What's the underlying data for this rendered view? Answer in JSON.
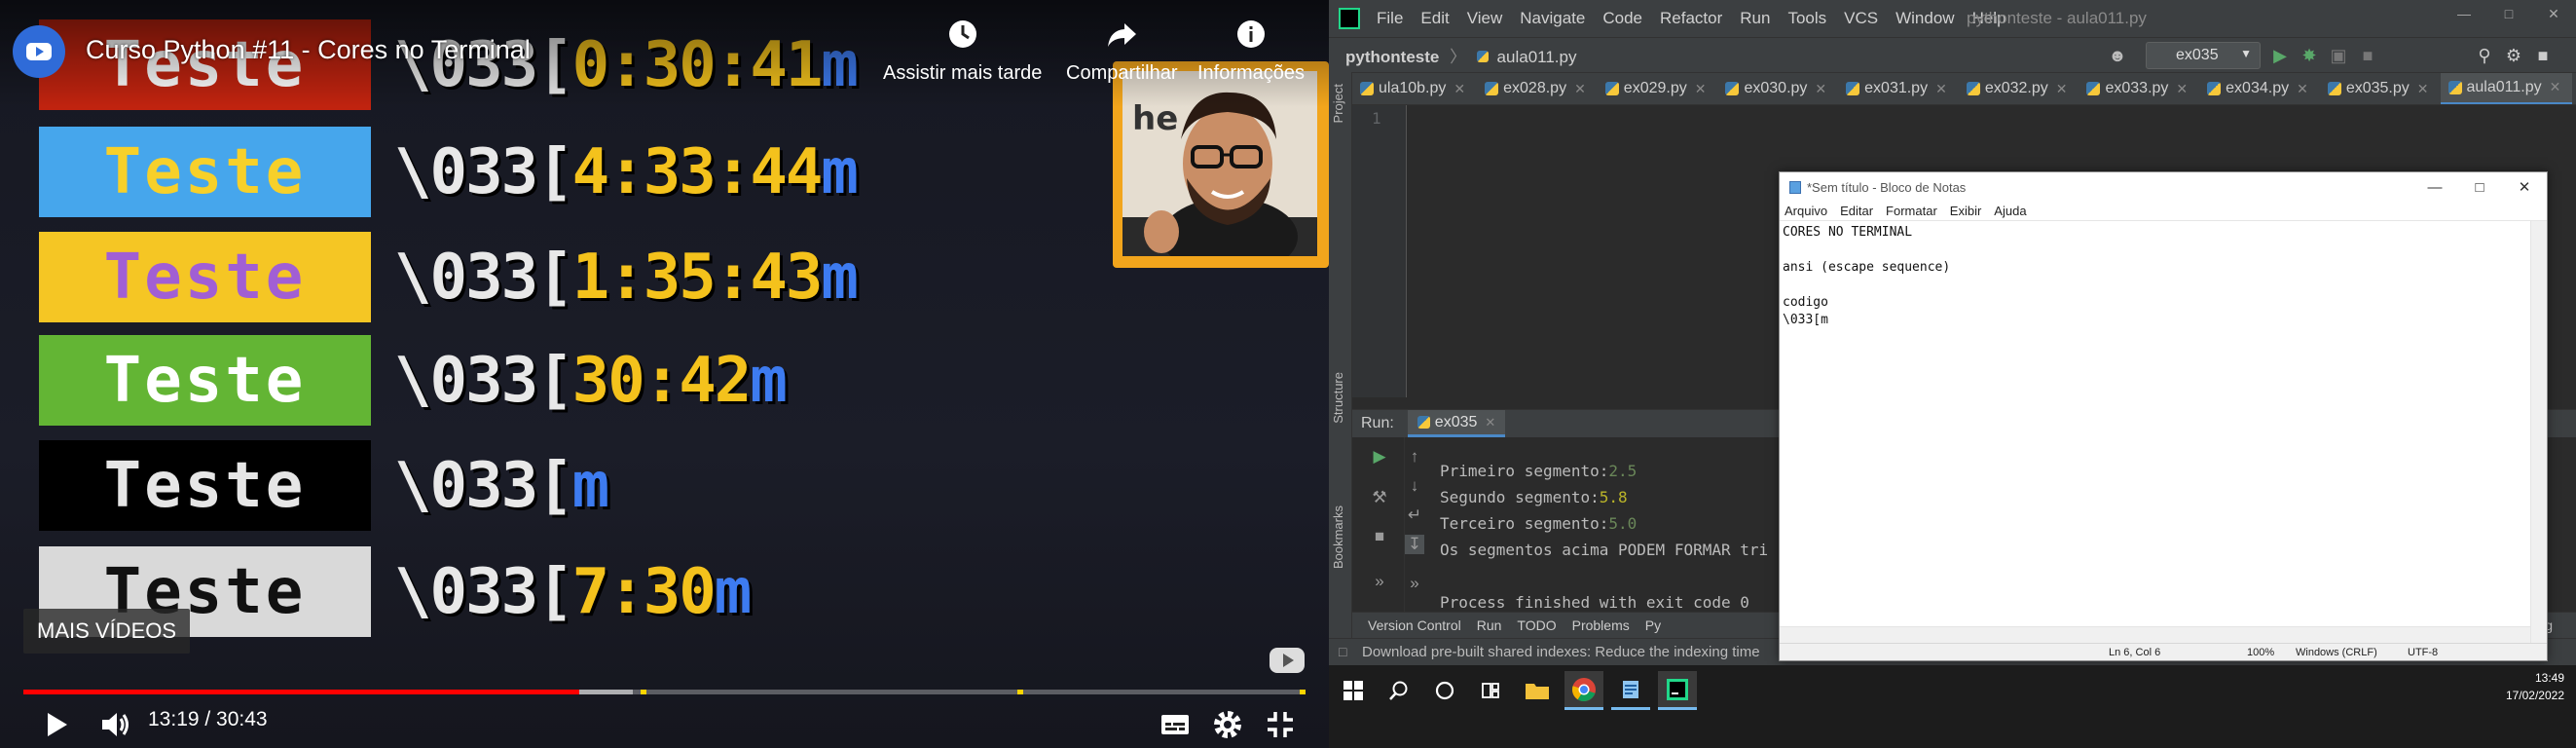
{
  "video": {
    "title": "Curso Python #11 - Cores no Terminal",
    "actions": {
      "watch_later": "Assistir mais tarde",
      "share": "Compartilhar",
      "info": "Informações"
    },
    "more_videos": "MAIS VÍDEOS",
    "time": "13:19 / 30:43",
    "progress_played_fraction": 0.4335,
    "progress_loaded_fraction": 0.475,
    "slide": {
      "rows": [
        {
          "box_text": "Teste",
          "box_bg": "#c0230f",
          "box_fg": "#ffffff",
          "code_prefix": "\\033",
          "code_bracket": "[",
          "code_args": "0:30:41",
          "code_m": "m"
        },
        {
          "box_text": "Teste",
          "box_bg": "#46a6ec",
          "box_fg": "#f7d02a",
          "code_prefix": "\\033",
          "code_bracket": "[",
          "code_args": "4:33:44",
          "code_m": "m"
        },
        {
          "box_text": "Teste",
          "box_bg": "#f5c624",
          "box_fg": "#a15fd4",
          "code_prefix": "\\033",
          "code_bracket": "[",
          "code_args": "1:35:43",
          "code_m": "m"
        },
        {
          "box_text": "Teste",
          "box_bg": "#63b534",
          "box_fg": "#ffffff",
          "code_prefix": "\\033",
          "code_bracket": "[",
          "code_args": "30:42",
          "code_m": "m"
        },
        {
          "box_text": "Teste",
          "box_bg": "#000000",
          "box_fg": "#e6e6e6",
          "code_prefix": "\\033",
          "code_bracket": "[",
          "code_args": "",
          "code_m": "m"
        },
        {
          "box_text": "Teste",
          "box_bg": "#d9d9d9",
          "box_fg": "#111111",
          "code_prefix": "\\033",
          "code_bracket": "[",
          "code_args": "7:30",
          "code_m": "m"
        }
      ]
    },
    "colors": {
      "progress_played": "#ff0000",
      "webcam_border": "#f2a51c",
      "logo_bg": "#2f6bd8"
    }
  },
  "ide": {
    "menu": [
      "File",
      "Edit",
      "View",
      "Navigate",
      "Code",
      "Refactor",
      "Run",
      "Tools",
      "VCS",
      "Window",
      "Help"
    ],
    "window_title": "pythonteste - aula011.py",
    "breadcrumb": {
      "project": "pythonteste",
      "file": "aula011.py"
    },
    "run_config": "ex035",
    "tabs": [
      {
        "label": "ula10b.py",
        "active": false
      },
      {
        "label": "ex028.py",
        "active": false
      },
      {
        "label": "ex029.py",
        "active": false
      },
      {
        "label": "ex030.py",
        "active": false
      },
      {
        "label": "ex031.py",
        "active": false
      },
      {
        "label": "ex032.py",
        "active": false
      },
      {
        "label": "ex033.py",
        "active": false
      },
      {
        "label": "ex034.py",
        "active": false
      },
      {
        "label": "ex035.py",
        "active": false
      },
      {
        "label": "aula011.py",
        "active": true
      }
    ],
    "side_labels": {
      "project": "Project",
      "structure": "Structure",
      "bookmarks": "Bookmarks"
    },
    "editor_line_number": "1",
    "run": {
      "label": "Run:",
      "tab": "ex035",
      "console": {
        "line1_label": "Primeiro segmento:",
        "line1_value": "2.5",
        "line2_label": "Segundo segmento:",
        "line2_value": "5.8",
        "line3_label": "Terceiro segmento:",
        "line3_value": "5.0",
        "line4": "Os segmentos acima PODEM FORMAR tri",
        "line5": "Process finished with exit code 0"
      }
    },
    "bottom_tabs": [
      "Version Control",
      "Run",
      "TODO",
      "Problems",
      "Py"
    ],
    "bottom_right": "Log",
    "status_message": "Download pre-built shared indexes: Reduce the indexing time"
  },
  "notepad": {
    "title": "*Sem título - Bloco de Notas",
    "menu": [
      "Arquivo",
      "Editar",
      "Formatar",
      "Exibir",
      "Ajuda"
    ],
    "content": "CORES NO TERMINAL\n\nansi (escape sequence)\n\ncodigo\n\\033[m",
    "status": {
      "position": "Ln 6, Col 6",
      "zoom": "100%",
      "line_endings": "Windows (CRLF)",
      "encoding": "UTF-8"
    }
  },
  "taskbar": {
    "time": "13:49",
    "date": "17/02/2022"
  }
}
